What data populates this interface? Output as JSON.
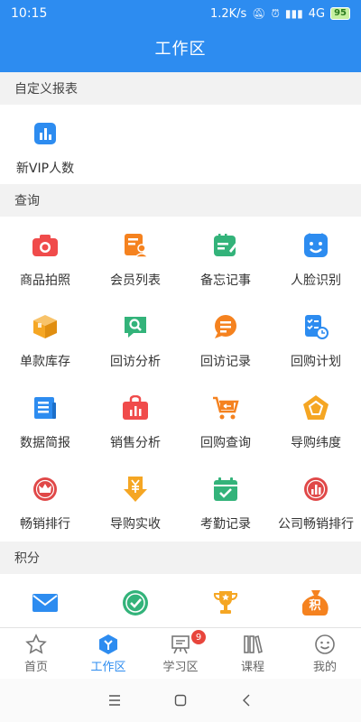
{
  "status": {
    "time": "10:15",
    "speed": "1.2K/s",
    "network": "4G",
    "battery": "95"
  },
  "header": {
    "title": "工作区"
  },
  "sections": [
    {
      "title": "自定义报表",
      "items": [
        {
          "label": "新VIP人数",
          "icon": "bar-chart-icon",
          "color": "#2d8cf0"
        }
      ]
    },
    {
      "title": "查询",
      "items": [
        {
          "label": "商品拍照",
          "icon": "camera-icon",
          "color": "#f04b4b"
        },
        {
          "label": "会员列表",
          "icon": "member-list-icon",
          "color": "#f5821f"
        },
        {
          "label": "备忘记事",
          "icon": "memo-icon",
          "color": "#33b37a"
        },
        {
          "label": "人脸识别",
          "icon": "face-icon",
          "color": "#2d8cf0"
        },
        {
          "label": "单款库存",
          "icon": "box-icon",
          "color": "#f5a623"
        },
        {
          "label": "回访分析",
          "icon": "search-chat-icon",
          "color": "#33b37a"
        },
        {
          "label": "回访记录",
          "icon": "chat-bubble-icon",
          "color": "#f5821f"
        },
        {
          "label": "回购计划",
          "icon": "checklist-clock-icon",
          "color": "#2d8cf0"
        },
        {
          "label": "数据简报",
          "icon": "newspaper-icon",
          "color": "#2d8cf0"
        },
        {
          "label": "销售分析",
          "icon": "bag-chart-icon",
          "color": "#f04b4b"
        },
        {
          "label": "回购查询",
          "icon": "cart-icon",
          "color": "#f5821f"
        },
        {
          "label": "导购纬度",
          "icon": "pentagon-icon",
          "color": "#f5a623"
        },
        {
          "label": "畅销排行",
          "icon": "crown-icon",
          "color": "#e04848"
        },
        {
          "label": "导购实收",
          "icon": "yuan-arrow-icon",
          "color": "#f5a623"
        },
        {
          "label": "考勤记录",
          "icon": "calendar-check-icon",
          "color": "#33b37a"
        },
        {
          "label": "公司畅销排行",
          "icon": "chart-circle-icon",
          "color": "#e04848"
        }
      ]
    },
    {
      "title": "积分",
      "items": [
        {
          "label": "",
          "icon": "mail-icon",
          "color": "#2d8cf0"
        },
        {
          "label": "",
          "icon": "check-circle-icon",
          "color": "#33b37a"
        },
        {
          "label": "",
          "icon": "trophy-icon",
          "color": "#f5a623"
        },
        {
          "label": "积",
          "icon": "points-bag-icon",
          "color": "#f5821f"
        }
      ]
    }
  ],
  "tabs": [
    {
      "label": "首页",
      "icon": "home-star-icon",
      "active": false
    },
    {
      "label": "工作区",
      "icon": "workspace-hex-icon",
      "active": true
    },
    {
      "label": "学习区",
      "icon": "study-board-icon",
      "active": false,
      "badge": "9"
    },
    {
      "label": "课程",
      "icon": "books-icon",
      "active": false
    },
    {
      "label": "我的",
      "icon": "smile-icon",
      "active": false
    }
  ]
}
